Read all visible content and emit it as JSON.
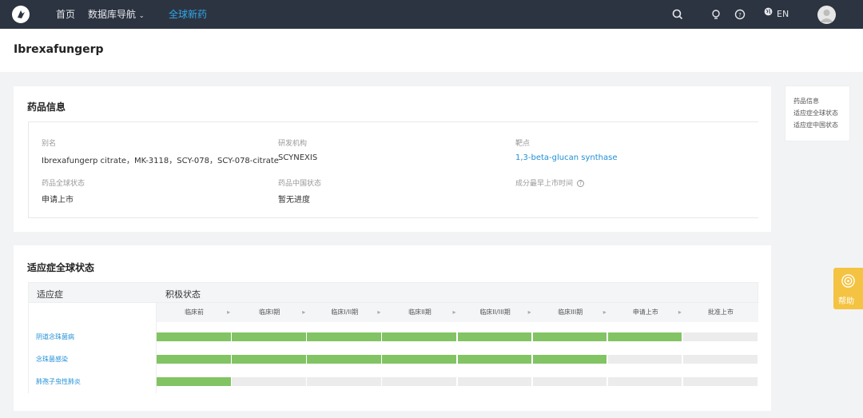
{
  "nav": {
    "items": [
      {
        "label": "首页"
      },
      {
        "label": "数据库导航"
      },
      {
        "label": "全球新药"
      }
    ],
    "language": "EN",
    "icons": [
      "search-icon",
      "bulb-icon",
      "help-circle-icon",
      "globe-icon",
      "user-avatar"
    ]
  },
  "page": {
    "title": "Ibrexafungerp"
  },
  "drug_info": {
    "title": "药品信息",
    "fields": [
      {
        "label": "别名",
        "value": "Ibrexafungerp citrate，MK-3118，SCY-078，SCY-078-citrate"
      },
      {
        "label": "研发机构",
        "value": "SCYNEXIS"
      },
      {
        "label": "靶点",
        "value": "1,3-beta-glucan synthase"
      },
      {
        "label": "药品全球状态",
        "value": "申请上市"
      },
      {
        "label": "药品中国状态",
        "value": "暂无进度"
      },
      {
        "label": "成分最早上市时间",
        "value": ""
      }
    ]
  },
  "global_status": {
    "title": "适应症全球状态",
    "col_indication": "适应症",
    "col_status": "积极状态",
    "phases": [
      "临床前",
      "临床I期",
      "临床I/II期",
      "临床II期",
      "临床II/III期",
      "临床III期",
      "申请上市",
      "批准上市"
    ],
    "indications": [
      {
        "name": "阴道念珠菌病",
        "completed": 7
      },
      {
        "name": "念珠菌感染",
        "completed": 6
      },
      {
        "name": "肺孢子虫性肺炎",
        "completed": 1
      }
    ]
  },
  "side_nav": {
    "items": [
      {
        "label": "药品信息"
      },
      {
        "label": "适应症全球状态"
      },
      {
        "label": "适应症中国状态"
      }
    ]
  },
  "help_button": {
    "label": "帮助"
  },
  "colors": {
    "nav_bg": "#2c3441",
    "accent": "#31a7e8",
    "progress_on": "#82c464",
    "progress_off": "#ececec",
    "help_bg": "#f5c342"
  }
}
